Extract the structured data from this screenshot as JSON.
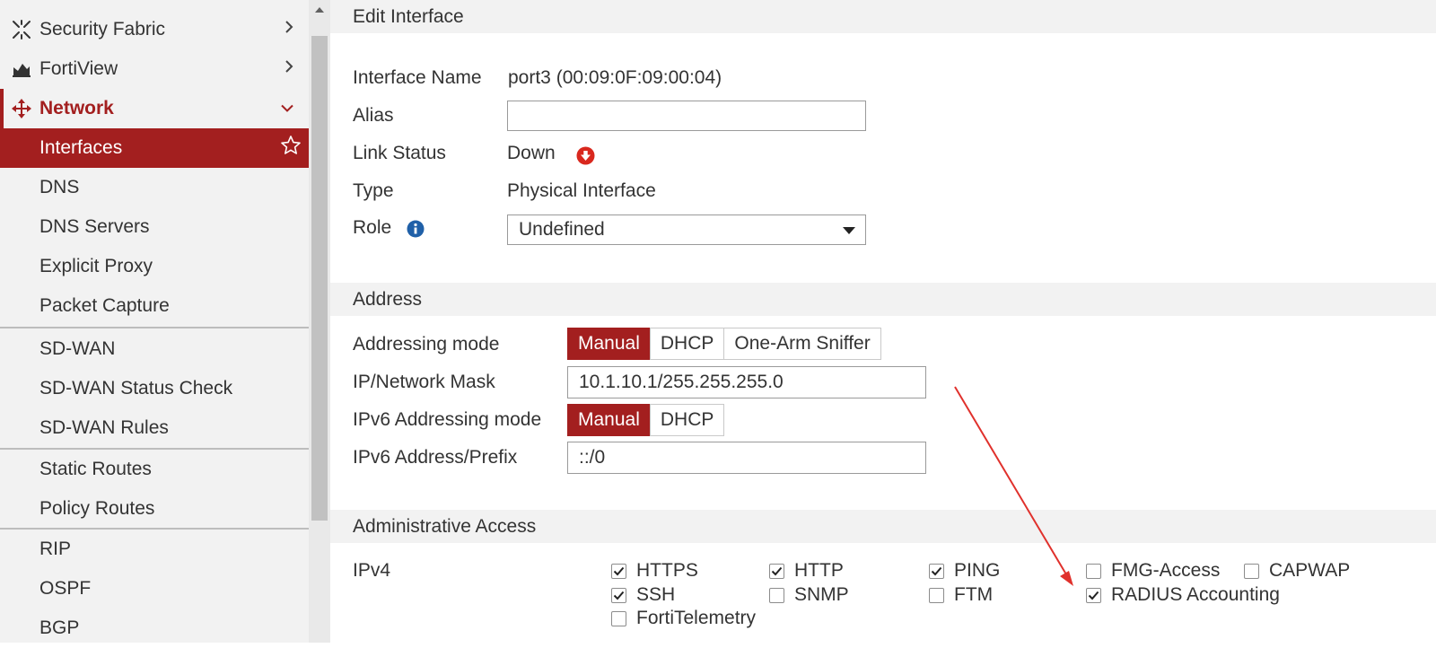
{
  "sidebar": {
    "items": [
      {
        "label": "Security Fabric",
        "icon": "security-fabric-icon"
      },
      {
        "label": "FortiView",
        "icon": "fortiview-icon"
      },
      {
        "label": "Network",
        "icon": "network-move-icon"
      },
      {
        "label": "Interfaces"
      },
      {
        "label": "DNS"
      },
      {
        "label": "DNS Servers"
      },
      {
        "label": "Explicit Proxy"
      },
      {
        "label": "Packet Capture"
      },
      {
        "label": "SD-WAN"
      },
      {
        "label": "SD-WAN Status Check"
      },
      {
        "label": "SD-WAN Rules"
      },
      {
        "label": "Static Routes"
      },
      {
        "label": "Policy Routes"
      },
      {
        "label": "RIP"
      },
      {
        "label": "OSPF"
      },
      {
        "label": "BGP"
      }
    ],
    "accent_color": "#a31f1f"
  },
  "edit": {
    "title": "Edit Interface",
    "interface_name_label": "Interface Name",
    "interface_name_value": "port3 (00:09:0F:09:00:04)",
    "alias_label": "Alias",
    "alias_value": "",
    "link_status_label": "Link Status",
    "link_status_value": "Down",
    "type_label": "Type",
    "type_value": "Physical Interface",
    "role_label": "Role",
    "role_value": "Undefined"
  },
  "address": {
    "title": "Address",
    "addressing_mode_label": "Addressing mode",
    "addressing_modes": [
      "Manual",
      "DHCP",
      "One-Arm Sniffer"
    ],
    "ip_mask_label": "IP/Network Mask",
    "ip_mask_value": "10.1.10.1/255.255.255.0",
    "ipv6_mode_label": "IPv6 Addressing mode",
    "ipv6_modes": [
      "Manual",
      "DHCP"
    ],
    "ipv6_prefix_label": "IPv6 Address/Prefix",
    "ipv6_prefix_value": "::/0"
  },
  "admin": {
    "title": "Administrative Access",
    "ipv4_label": "IPv4",
    "options": {
      "https": {
        "label": "HTTPS",
        "checked": true
      },
      "http": {
        "label": "HTTP",
        "checked": true
      },
      "ping": {
        "label": "PING",
        "checked": true
      },
      "fmg": {
        "label": "FMG-Access",
        "checked": false
      },
      "capwap": {
        "label": "CAPWAP",
        "checked": false
      },
      "ssh": {
        "label": "SSH",
        "checked": true
      },
      "snmp": {
        "label": "SNMP",
        "checked": false
      },
      "ftm": {
        "label": "FTM",
        "checked": false
      },
      "radius": {
        "label": "RADIUS Accounting",
        "checked": true
      },
      "fortitelemetry": {
        "label": "FortiTelemetry",
        "checked": false
      }
    }
  }
}
